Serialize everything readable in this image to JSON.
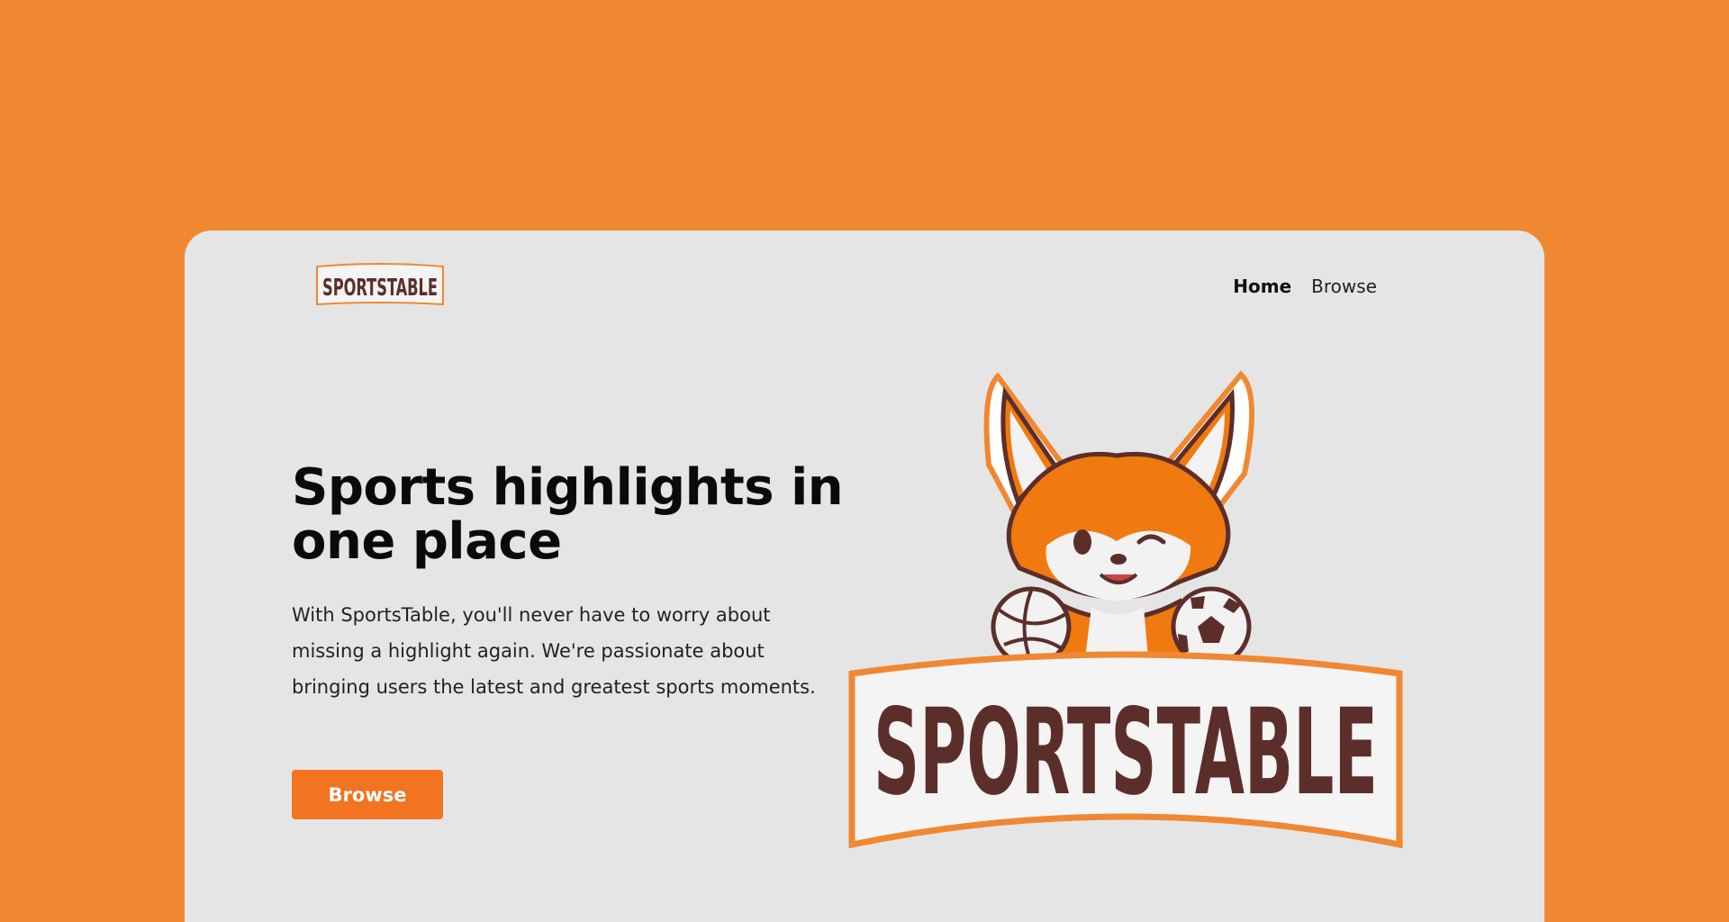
{
  "nav": {
    "logo_text": "SPORTSTABLE",
    "items": [
      {
        "label": "Home",
        "active": true
      },
      {
        "label": "Browse",
        "active": false
      }
    ]
  },
  "hero": {
    "title": "Sports highlights in one place",
    "description": "With SportsTable, you'll never have to worry about missing a highlight again. We're passionate about bringing users the latest and greatest sports moments.",
    "button_label": "Browse",
    "mascot_wordmark": "SPORTSTABLE"
  },
  "colors": {
    "background": "#F08833",
    "card": "#E5E5E5",
    "accent": "#F27320",
    "logo_brown": "#5C2E2A"
  }
}
